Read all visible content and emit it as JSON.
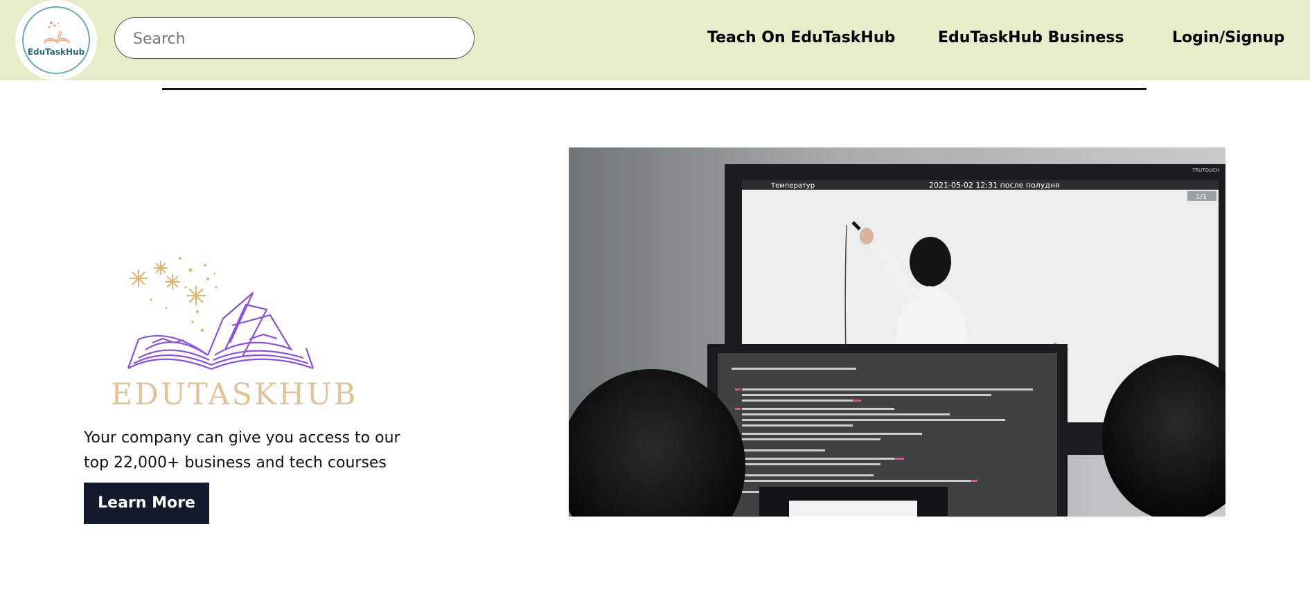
{
  "header": {
    "logo_text": "EduTaskHub",
    "search_placeholder": "Search",
    "search_value": "",
    "nav": {
      "teach": "Teach On EduTaskHub",
      "business": "EduTaskHub Business",
      "login": "Login/Signup"
    }
  },
  "hero": {
    "wordmark": "EDUTASKHUB",
    "tagline": "Your company can give you access to our top 22,000+ business and tech courses",
    "cta_label": "Learn More >>",
    "screen_header": "2021-05-02  12:31  после полудня",
    "screen_left_label": "Температур",
    "screen_page": "1/1",
    "monitor_brand": "TRUTOUCH"
  },
  "colors": {
    "topbar": "#e8edc9",
    "cta_bg": "#121a2b",
    "book_purple": "#8a4fe8",
    "sparkle_gold": "#e3b46e",
    "wordmark_gold": "#e2c398",
    "logo_ring": "#67aab2"
  }
}
